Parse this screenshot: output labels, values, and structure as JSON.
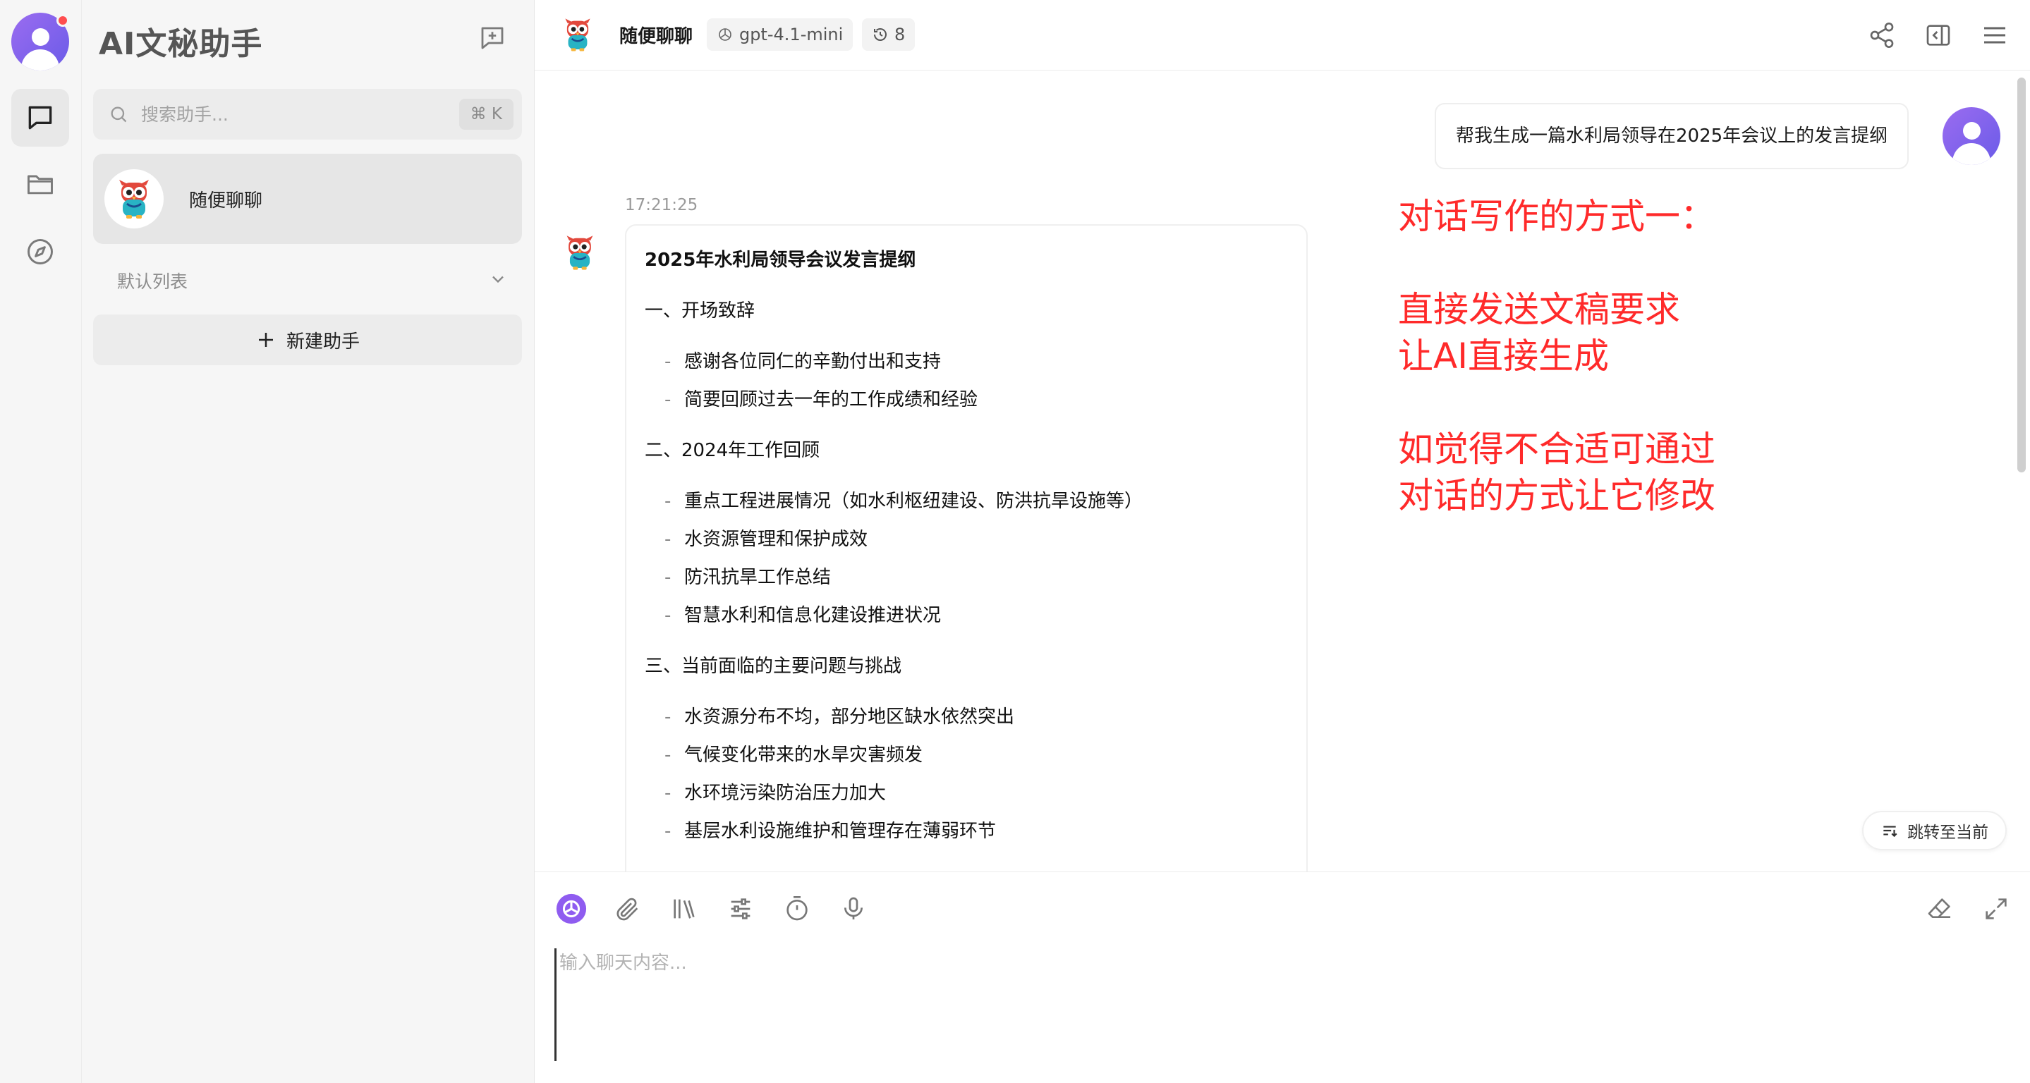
{
  "sidebar": {
    "title": "AI文秘助手",
    "search_placeholder": "搜索助手...",
    "search_shortcut": "⌘ K",
    "assistant_name": "随便聊聊",
    "group_label": "默认列表",
    "add_assistant_label": "新建助手"
  },
  "header": {
    "title": "随便聊聊",
    "model": "gpt-4.1-mini",
    "history_count": "8"
  },
  "chat": {
    "user_message": "帮我生成一篇水利局领导在2025年会议上的发言提纲",
    "timestamp": "17:21:25",
    "answer_title": "2025年水利局领导会议发言提纲",
    "sections": [
      {
        "heading": "一、开场致辞",
        "items": [
          "感谢各位同仁的辛勤付出和支持",
          "简要回顾过去一年的工作成绩和经验"
        ]
      },
      {
        "heading": "二、2024年工作回顾",
        "items": [
          "重点工程进展情况（如水利枢纽建设、防洪抗旱设施等）",
          "水资源管理和保护成效",
          "防汛抗旱工作总结",
          "智慧水利和信息化建设推进状况"
        ]
      },
      {
        "heading": "三、当前面临的主要问题与挑战",
        "items": [
          "水资源分布不均，部分地区缺水依然突出",
          "气候变化带来的水旱灾害频发",
          "水环境污染防治压力加大",
          "基层水利设施维护和管理存在薄弱环节"
        ]
      }
    ],
    "annotation": {
      "line1": "对话写作的方式一：",
      "line2": "直接发送文稿要求",
      "line3": "让AI直接生成",
      "line4": "如觉得不合适可通过",
      "line5": "对话的方式让它修改"
    },
    "jump_label": "跳转至当前"
  },
  "composer": {
    "placeholder": "输入聊天内容..."
  },
  "colors": {
    "accent": "#8f5cf0",
    "annotation": "#ff2a2a"
  }
}
